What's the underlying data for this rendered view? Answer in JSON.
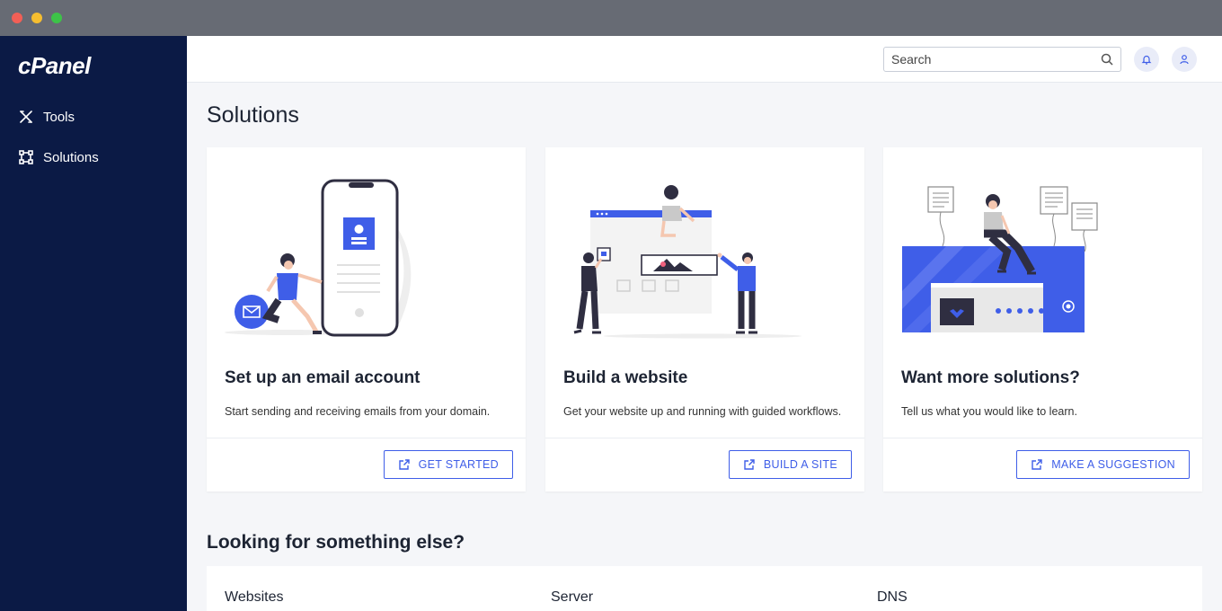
{
  "window": {
    "controls": [
      "close",
      "minimize",
      "maximize"
    ]
  },
  "sidebar": {
    "logo": "cPanel",
    "items": [
      {
        "label": "Tools",
        "icon": "tools-icon"
      },
      {
        "label": "Solutions",
        "icon": "solutions-icon"
      }
    ]
  },
  "topbar": {
    "search": {
      "placeholder": "Search",
      "value": ""
    },
    "icons": [
      "bell-icon",
      "user-icon"
    ]
  },
  "main": {
    "title": "Solutions",
    "cards": [
      {
        "title": "Set up an email account",
        "description": "Start sending and receiving emails from your domain.",
        "button": "GET STARTED"
      },
      {
        "title": "Build a website",
        "description": "Get your website up and running with guided workflows.",
        "button": "BUILD A SITE"
      },
      {
        "title": "Want more solutions?",
        "description": "Tell us what you would like to learn.",
        "button": "MAKE A SUGGESTION"
      }
    ],
    "more_title": "Looking for something else?",
    "categories": [
      "Websites",
      "Server",
      "DNS"
    ]
  },
  "colors": {
    "sidebar": "#0b1a45",
    "accent": "#3f5ee8",
    "background": "#f5f6f9"
  }
}
